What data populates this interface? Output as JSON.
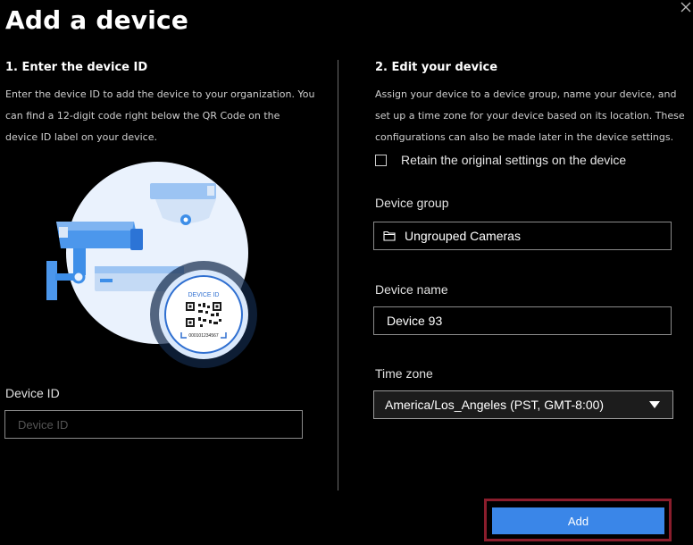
{
  "dialog": {
    "title": "Add a device",
    "close_icon": "close-icon"
  },
  "left": {
    "heading": "1. Enter the device ID",
    "description_lines": [
      "Enter the device ID to add the device to your organization. You",
      "can find a 12-digit code right below the QR Code on the",
      "device ID label on your device."
    ],
    "illustration": {
      "tag_text": "DEVICE ID",
      "code_text": "000101234567",
      "icons": [
        "camera-illustration",
        "qr-code-icon"
      ]
    },
    "device_id_label": "Device ID",
    "device_id_placeholder": "Device ID",
    "device_id_value": ""
  },
  "right": {
    "heading": "2. Edit your device",
    "description_lines": [
      "Assign your device to a device group, name your device, and",
      "set up a time zone for your device based on its location. These",
      "configurations can also be made later in the device settings."
    ],
    "retain_checkbox": {
      "label": "Retain the original settings on the device",
      "checked": false
    },
    "device_group_label": "Device group",
    "device_group_value": "Ungrouped Cameras",
    "device_name_label": "Device name",
    "device_name_value": "Device 93",
    "time_zone_label": "Time zone",
    "time_zone_value": "America/Los_Angeles (PST, GMT-8:00)"
  },
  "footer": {
    "add_label": "Add"
  },
  "colors": {
    "background": "#000000",
    "primary_button": "#3a86e8",
    "focus_outline": "#8a1d2c",
    "illustration_circle": "#eaf2fd",
    "illustration_blue": "#3d8ee8"
  }
}
